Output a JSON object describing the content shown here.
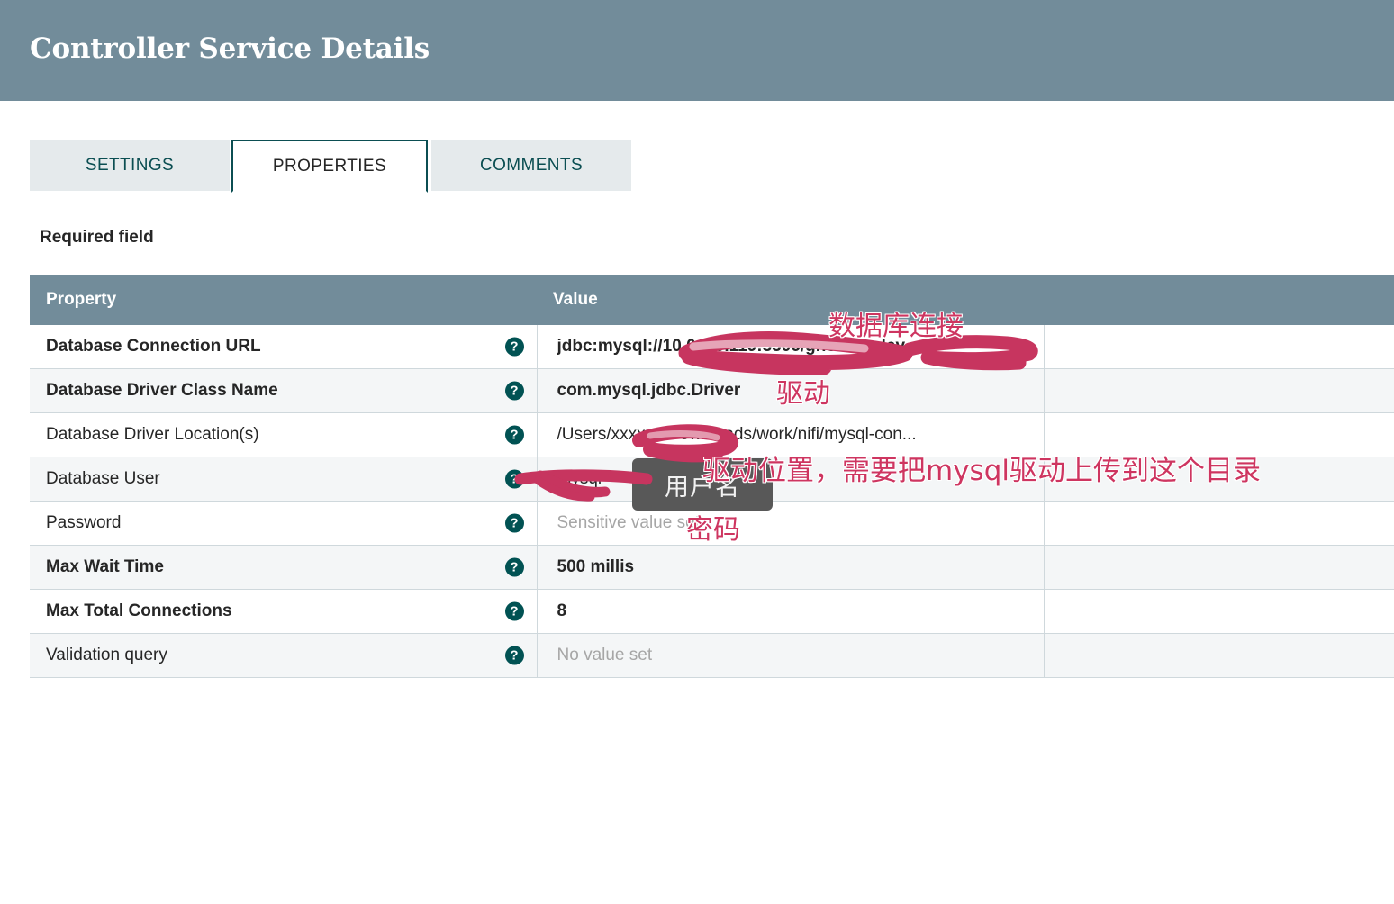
{
  "header": {
    "title": "Controller Service Details",
    "bg_color": "#728C9A"
  },
  "tabs": [
    {
      "label": "SETTINGS",
      "active": false
    },
    {
      "label": "PROPERTIES",
      "active": true
    },
    {
      "label": "COMMENTS",
      "active": false
    }
  ],
  "required_field_label": "Required field",
  "table": {
    "columns": [
      "Property",
      "Value"
    ],
    "help_icon_glyph": "?",
    "rows": [
      {
        "property": "Database Connection URL",
        "required": true,
        "value": "jdbc:mysql://10.0.0.0.119:3306/ghouse_dev",
        "value_is_placeholder": false,
        "redacted": true
      },
      {
        "property": "Database Driver Class Name",
        "required": true,
        "value": "com.mysql.jdbc.Driver",
        "value_is_placeholder": false,
        "redacted": false
      },
      {
        "property": "Database Driver Location(s)",
        "required": false,
        "value": "/Users/xxxxxx/Downloads/work/nifi/mysql-con...",
        "value_is_placeholder": false,
        "redacted": true
      },
      {
        "property": "Database User",
        "required": false,
        "value": "mysql",
        "value_is_placeholder": false,
        "redacted": true
      },
      {
        "property": "Password",
        "required": false,
        "value": "Sensitive value set",
        "value_is_placeholder": true,
        "redacted": false
      },
      {
        "property": "Max Wait Time",
        "required": true,
        "value": "500 millis",
        "value_is_placeholder": false,
        "redacted": false
      },
      {
        "property": "Max Total Connections",
        "required": true,
        "value": "8",
        "value_is_placeholder": false,
        "redacted": false
      },
      {
        "property": "Validation query",
        "required": false,
        "value": "No value set",
        "value_is_placeholder": true,
        "redacted": false
      }
    ]
  },
  "tooltip": {
    "text": "用户名"
  },
  "annotations": {
    "color": "#CE3560",
    "database_connection": "数据库连接",
    "driver": "驱动",
    "driver_location": "驱动位置，需要把mysql驱动上传到这个目录",
    "password": "密码"
  }
}
